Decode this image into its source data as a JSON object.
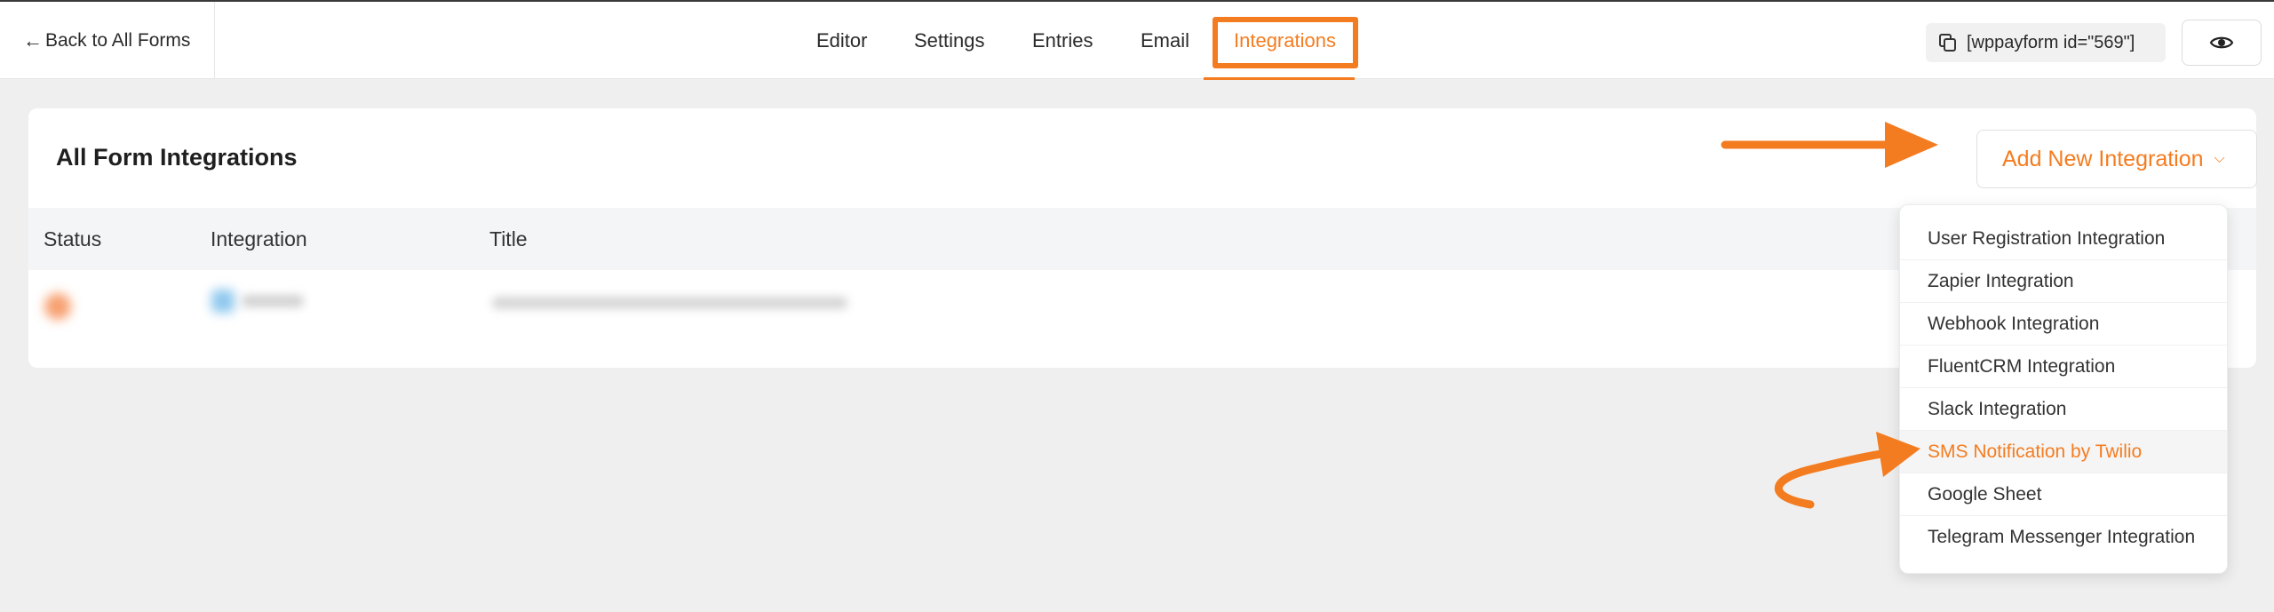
{
  "colors": {
    "accent": "#f47c20",
    "page_bg": "#efefef",
    "card_bg": "#ffffff"
  },
  "topbar": {
    "back_label": "Back to All Forms",
    "tabs": [
      {
        "label": "Editor",
        "active": false
      },
      {
        "label": "Settings",
        "active": false
      },
      {
        "label": "Entries",
        "active": false
      },
      {
        "label": "Email",
        "active": false
      },
      {
        "label": "Integrations",
        "active": true
      }
    ],
    "shortcode": "[wppayform id=\"569\"]",
    "preview_icon": "eye-icon"
  },
  "card": {
    "title": "All Form Integrations",
    "add_button_label": "Add New Integration",
    "columns": [
      "Status",
      "Integration",
      "Title"
    ]
  },
  "dropdown": {
    "items": [
      "User Registration Integration",
      "Zapier Integration",
      "Webhook Integration",
      "FluentCRM Integration",
      "Slack Integration",
      "SMS Notification by Twilio",
      "Google Sheet",
      "Telegram Messenger Integration"
    ],
    "highlighted_index": 5
  }
}
